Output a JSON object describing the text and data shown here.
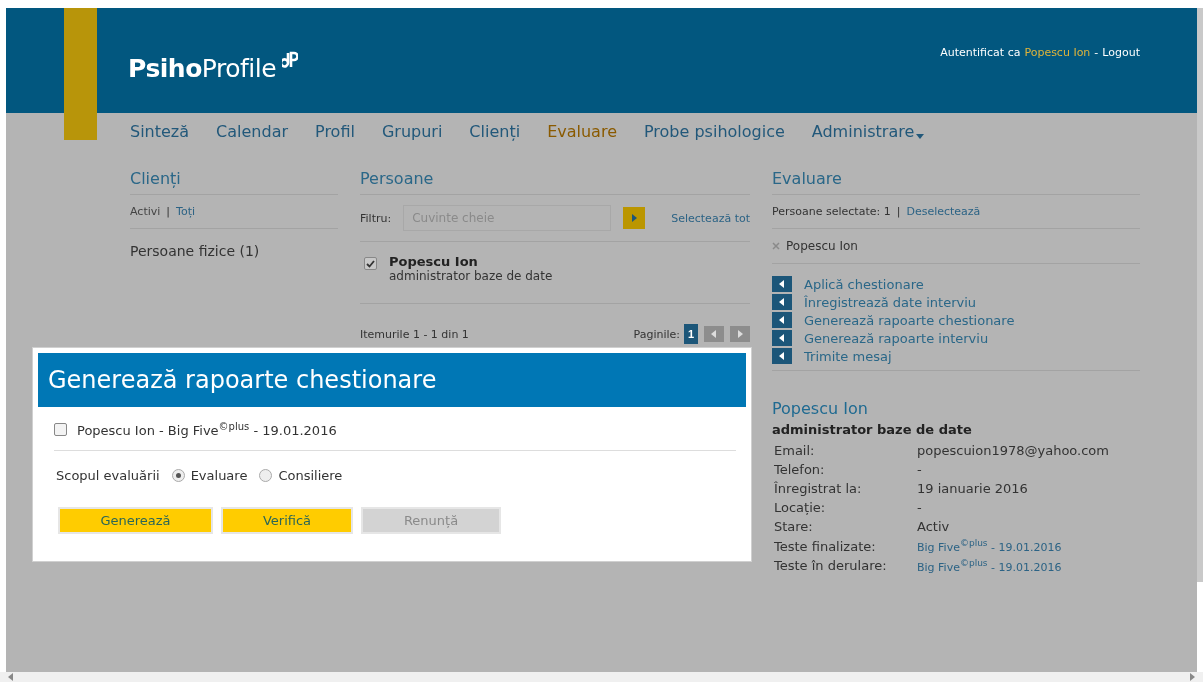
{
  "header": {
    "logo_bold": "Psiho",
    "logo_regular": "Profile",
    "auth_label": "Autentificat ca",
    "user": "Popescu Ion",
    "separator": "-",
    "logout": "Logout"
  },
  "nav": [
    {
      "label": "Sinteză",
      "selected": false,
      "has_menu": false
    },
    {
      "label": "Calendar",
      "selected": false,
      "has_menu": false
    },
    {
      "label": "Profil",
      "selected": false,
      "has_menu": false
    },
    {
      "label": "Grupuri",
      "selected": false,
      "has_menu": false
    },
    {
      "label": "Clienți",
      "selected": false,
      "has_menu": false
    },
    {
      "label": "Evaluare",
      "selected": true,
      "has_menu": false
    },
    {
      "label": "Probe psihologice",
      "selected": false,
      "has_menu": false
    },
    {
      "label": "Administrare",
      "selected": false,
      "has_menu": true
    }
  ],
  "clients": {
    "title": "Clienți",
    "filters": [
      {
        "label": "Activi",
        "selected": true
      },
      {
        "label": "Toți",
        "selected": false
      }
    ],
    "separator": "|",
    "groups": [
      "Persoane fizice (1)"
    ]
  },
  "persons": {
    "title": "Persoane",
    "filter_label": "Filtru:",
    "filter_placeholder": "Cuvinte cheie",
    "select_all": "Selectează tot",
    "items": [
      {
        "name": "Popescu Ion",
        "role": "administrator baze de date",
        "checked": true
      }
    ],
    "summary": "Itemurile 1 - 1 din 1",
    "pages_label": "Paginile:",
    "pages": [
      {
        "label": "1",
        "selected": true
      }
    ]
  },
  "evaluation": {
    "title": "Evaluare",
    "selected_label": "Persoane selectate: 1",
    "separator": "|",
    "deselect": "Deselectează",
    "selected_people": [
      "Popescu Ion"
    ],
    "actions": [
      "Aplică chestionare",
      "Înregistrează date interviu",
      "Generează rapoarte chestionare",
      "Generează rapoarte interviu",
      "Trimite mesaj"
    ],
    "profile": {
      "name": "Popescu Ion",
      "role": "administrator baze de date",
      "fields": [
        {
          "label": "Email:",
          "value": "popescuion1978@yahoo.com",
          "kind": "text"
        },
        {
          "label": "Telefon:",
          "value": "-",
          "kind": "text"
        },
        {
          "label": "Înregistrat la:",
          "value": "19 ianuarie 2016",
          "kind": "text"
        },
        {
          "label": "Locație:",
          "value": "-",
          "kind": "text"
        },
        {
          "label": "Stare:",
          "value": "Activ",
          "kind": "text"
        },
        {
          "label": "Teste finalizate:",
          "value": "Big Five$^{©plus}$ - 19.01.2016",
          "kind": "link"
        },
        {
          "label": "Teste în derulare:",
          "value": "Big Five$^{©plus}$ - 19.01.2016",
          "kind": "link"
        }
      ]
    }
  },
  "modal": {
    "title": "Generează rapoarte chestionare",
    "tests": [
      {
        "label": "Popescu Ion - Big Five$^{©plus}$ - 19.01.2016",
        "checked": false
      }
    ],
    "purpose_label": "Scopul evaluării",
    "purposes": [
      {
        "label": "Evaluare",
        "selected": true
      },
      {
        "label": "Consiliere",
        "selected": false
      }
    ],
    "buttons": [
      {
        "label": "Generează",
        "disabled": false
      },
      {
        "label": "Verifică",
        "disabled": false
      },
      {
        "label": "Renunță",
        "disabled": true
      }
    ]
  }
}
